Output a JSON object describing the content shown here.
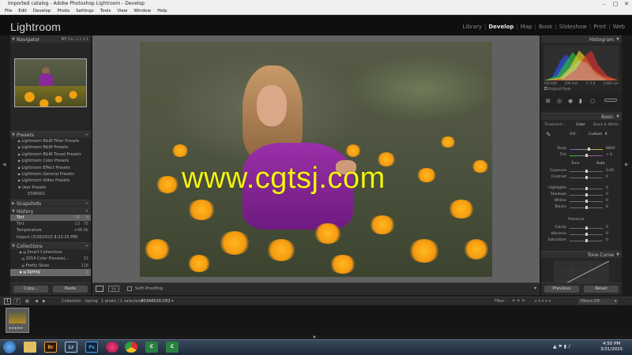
{
  "window": {
    "title": "Imported catalog - Adobe Photoshop Lightroom - Develop",
    "menu": [
      "File",
      "Edit",
      "Develop",
      "Photo",
      "Settings",
      "Tools",
      "View",
      "Window",
      "Help"
    ]
  },
  "app": {
    "logo": "Lightroom",
    "modules": [
      "Library",
      "Develop",
      "Map",
      "Book",
      "Slideshow",
      "Print",
      "Web"
    ],
    "active_module": "Develop"
  },
  "navigator": {
    "title": "Navigator",
    "zoom_options": [
      "FIT",
      "FILL",
      "1:1",
      "3:1"
    ]
  },
  "presets": {
    "title": "Presets",
    "items": [
      "Lightroom B&W Filter Presets",
      "Lightroom B&W Presets",
      "Lightroom B&W Toned Presets",
      "Lightroom Color Presets",
      "Lightroom Effect Presets",
      "Lightroom General Presets",
      "Lightroom Video Presets",
      "User Presets",
      "STARS01"
    ]
  },
  "snapshots": {
    "title": "Snapshots"
  },
  "history": {
    "title": "History",
    "items": [
      {
        "label": "Tint",
        "from": "-78",
        "to": "6"
      },
      {
        "label": "Tint",
        "from": "-13",
        "to": "75"
      },
      {
        "label": "Temperature",
        "from": "+4",
        "to": "6.0k"
      },
      {
        "label": "Import (3/28/2015 8:22:25 PM)",
        "from": "",
        "to": ""
      }
    ]
  },
  "collections": {
    "title": "Collections",
    "items": [
      {
        "label": "Smart Collections",
        "count": ""
      },
      {
        "label": "2014 Color Processi...",
        "count": "32"
      },
      {
        "label": "Pretty Skies",
        "count": "116"
      },
      {
        "label": "Spring",
        "count": "1"
      }
    ]
  },
  "left_buttons": {
    "copy": "Copy...",
    "paste": "Paste"
  },
  "toolbar": {
    "soft_proofing": "Soft Proofing"
  },
  "watermark": "www.cgtsj.com",
  "histogram": {
    "title": "Histogram",
    "info": [
      "ISO 640",
      "200 mm",
      "f / 2.0",
      "1/400 sec"
    ],
    "original_photo": "Original Photo"
  },
  "basic": {
    "title": "Basic",
    "treatment_label": "Treatment :",
    "treatment_options": [
      "Color",
      "Black & White"
    ],
    "wb_label": "WB :",
    "wb_value": "Custom",
    "tone_label": "Tone",
    "auto_label": "Auto",
    "presence_label": "Presence",
    "sliders": [
      {
        "label": "Temp",
        "value": "6850"
      },
      {
        "label": "Tint",
        "value": "+ 6"
      },
      {
        "label": "Exposure",
        "value": "0.00"
      },
      {
        "label": "Contrast",
        "value": "0"
      },
      {
        "label": "Highlights",
        "value": "0"
      },
      {
        "label": "Shadows",
        "value": "0"
      },
      {
        "label": "Whites",
        "value": "0"
      },
      {
        "label": "Blacks",
        "value": "0"
      },
      {
        "label": "Clarity",
        "value": "0"
      },
      {
        "label": "Vibrance",
        "value": "0"
      },
      {
        "label": "Saturation",
        "value": "0"
      }
    ]
  },
  "tone_curve": {
    "title": "Tone Curve"
  },
  "right_buttons": {
    "previous": "Previous",
    "reset": "Reset"
  },
  "filmstrip": {
    "page1": "1",
    "page2": "2",
    "source": "Collection : Spring",
    "count": "1 photo / 1 selected /",
    "filename": "A03A6520.CR2",
    "filter_label": "Filter :",
    "filter_value": "Filters Off"
  },
  "taskbar": {
    "time": "4:50 PM",
    "date": "3/31/2015",
    "apps": [
      "Br",
      "Lr",
      "Ps"
    ]
  },
  "colors": {
    "accent_yellow": "#f4f40f",
    "panel_bg": "#262626",
    "lr_red": "#e03030"
  }
}
